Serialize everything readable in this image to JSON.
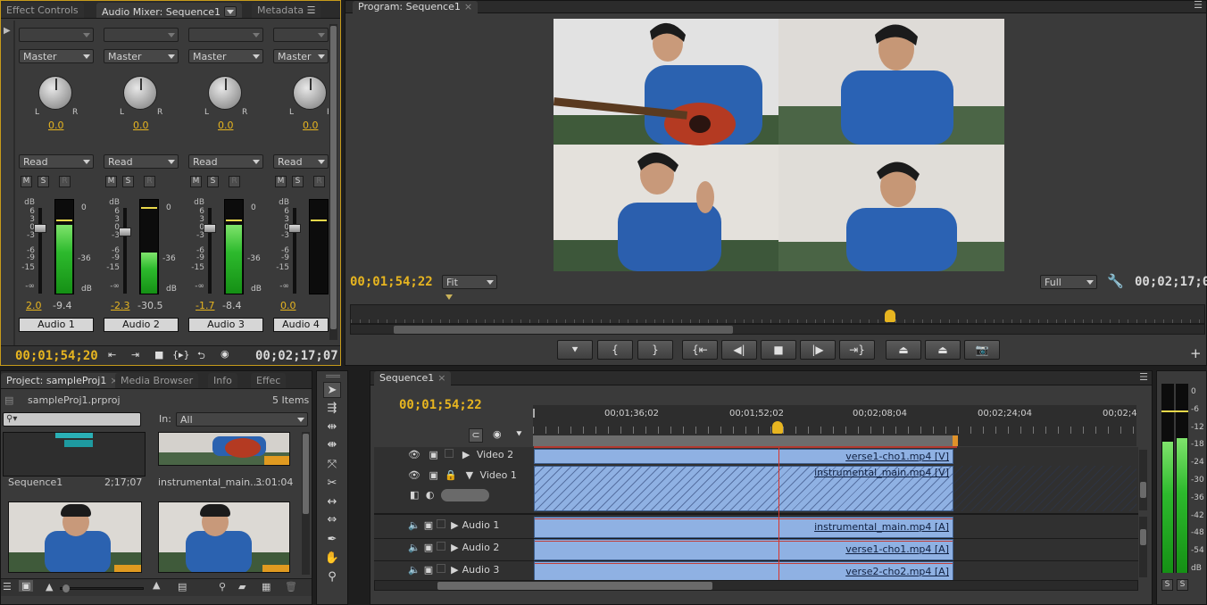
{
  "audio_panel": {
    "tabs": [
      "Effect Controls",
      "Audio Mixer: Sequence1",
      "Metadata"
    ],
    "channels": [
      {
        "output": "Master",
        "pan": "0.0",
        "mode": "Read",
        "vol": "2.0",
        "peak": "-9.4",
        "name": "Audio 1",
        "level": 0.74
      },
      {
        "output": "Master",
        "pan": "0.0",
        "mode": "Read",
        "vol": "-2.3",
        "peak": "-30.5",
        "name": "Audio 2",
        "level": 0.44
      },
      {
        "output": "Master",
        "pan": "0.0",
        "mode": "Read",
        "vol": "-1.7",
        "peak": "-8.4",
        "name": "Audio 3",
        "level": 0.74
      },
      {
        "output": "Master",
        "pan": "0.0",
        "mode": "Read",
        "vol": "0.0",
        "peak": "",
        "name": "Audio 4",
        "level": 0.0
      }
    ],
    "fader_scale": [
      "dB",
      "6",
      "3",
      "0",
      "-3",
      "-6",
      "-9",
      "-15",
      "-∞"
    ],
    "meter_scale": [
      "0",
      "-36",
      "dB"
    ],
    "lr": {
      "l": "L",
      "r": "R"
    },
    "msr": {
      "m": "M",
      "s": "S",
      "r": "R"
    },
    "timecode": "00;01;54;20",
    "duration": "00;02;17;07"
  },
  "program_monitor": {
    "tab": "Program: Sequence1",
    "timecode": "00;01;54;22",
    "fit": "Fit",
    "quality": "Full",
    "duration": "00;02;17;07"
  },
  "project_panel": {
    "tabs": [
      "Project: sampleProj1",
      "Media Browser",
      "Info",
      "Effec"
    ],
    "file": "sampleProj1.prproj",
    "items_count": "5 Items",
    "in_label": "In:",
    "in_value": "All",
    "items": [
      {
        "name": "Sequence1",
        "duration": "2;17;07"
      },
      {
        "name": "instrumental_main....",
        "duration": "3:01:04"
      }
    ]
  },
  "timeline": {
    "tab": "Sequence1",
    "timecode": "00;01;54;22",
    "ruler": [
      "00;01;36;02",
      "00;01;52;02",
      "00;02;08;04",
      "00;02;24;04",
      "00;02;4"
    ],
    "tracks": [
      {
        "name": "Video 2",
        "clip": "verse1-cho1.mp4 [V]"
      },
      {
        "name": "Video 1",
        "clip": "instrumental_main.mp4 [V]"
      },
      {
        "name": "Audio 1",
        "clip": "instrumental_main.mp4 [A]"
      },
      {
        "name": "Audio 2",
        "clip": "verse1-cho1.mp4 [A]"
      },
      {
        "name": "Audio 3",
        "clip": "verse2-cho2.mp4 [A]"
      }
    ]
  },
  "master_meter": {
    "scale": [
      "0",
      "-6",
      "-12",
      "-18",
      "-24",
      "-30",
      "-36",
      "-42",
      "-48",
      "-54",
      "dB"
    ],
    "solo": [
      "S",
      "S"
    ],
    "level_left": 0.7,
    "level_right": 0.72
  },
  "colors": {
    "accent": "#e7b520",
    "clip": "#8fb1e3",
    "playhead": "#d9342b"
  },
  "icons": [
    "play-icon",
    "marker-icon",
    "in-point-icon",
    "out-point-icon",
    "step-back-icon",
    "stop-icon",
    "step-forward-icon",
    "lift-icon",
    "extract-icon",
    "camera-icon",
    "wrench-icon",
    "selection-tool-icon",
    "hand-tool-icon",
    "zoom-tool-icon",
    "pen-tool-icon",
    "eye-icon",
    "speaker-icon",
    "lock-icon"
  ]
}
